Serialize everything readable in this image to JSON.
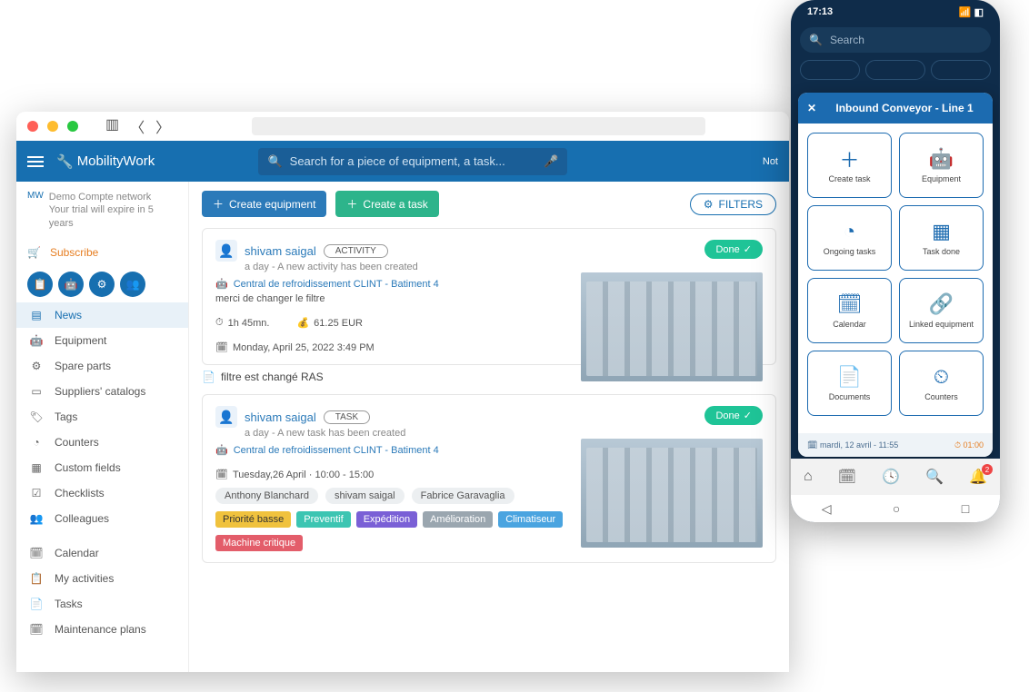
{
  "desktop": {
    "brand": "MobilityWork",
    "search_placeholder": "Search for a piece of equipment, a task...",
    "notif": "Not",
    "account_name": "Demo Compte network",
    "trial_note": "Your trial will expire in 5 years",
    "subscribe": "Subscribe",
    "nav": {
      "news": "News",
      "equipment": "Equipment",
      "spare": "Spare parts",
      "suppliers": "Suppliers' catalogs",
      "tags": "Tags",
      "counters": "Counters",
      "custom": "Custom fields",
      "checklists": "Checklists",
      "colleagues": "Colleagues",
      "calendar": "Calendar",
      "my_activities": "My activities",
      "tasks": "Tasks",
      "plans": "Maintenance plans"
    },
    "toolbar": {
      "create_equipment": "Create equipment",
      "create_task": "Create a task",
      "filters": "FILTERS"
    },
    "card1": {
      "user": "shivam saigal",
      "badge": "ACTIVITY",
      "status": "Done",
      "sub": "a day - A new activity has been created",
      "link": "Central de refroidissement CLINT - Batiment 4",
      "note": "merci de changer le filtre",
      "duration": "1h 45mn.",
      "cost": "61.25 EUR",
      "date": "Monday, April 25, 2022 3:49 PM",
      "footnote": "filtre est changé RAS"
    },
    "card2": {
      "user": "shivam saigal",
      "badge": "TASK",
      "status": "Done",
      "sub": "a day - A new task has been created",
      "link": "Central de refroidissement CLINT - Batiment 4",
      "date": "Tuesday,26 April · 10:00 - 15:00",
      "people": [
        "Anthony Blanchard",
        "shivam saigal",
        "Fabrice Garavaglia"
      ],
      "tags": [
        "Priorité basse",
        "Preventif",
        "Expédition",
        "Amélioration",
        "Climatiseur",
        "Machine critique"
      ]
    }
  },
  "phone": {
    "time": "17:13",
    "search_placeholder": "Search",
    "sheet_title": "Inbound Conveyor - Line 1",
    "tiles": {
      "create": "Create task",
      "equipment": "Equipment",
      "ongoing": "Ongoing tasks",
      "done": "Task done",
      "calendar": "Calendar",
      "linked": "Linked equipment",
      "documents": "Documents",
      "counters": "Counters"
    },
    "foot_date": "mardi, 12 avril - 11:55",
    "foot_time": "01:00"
  }
}
